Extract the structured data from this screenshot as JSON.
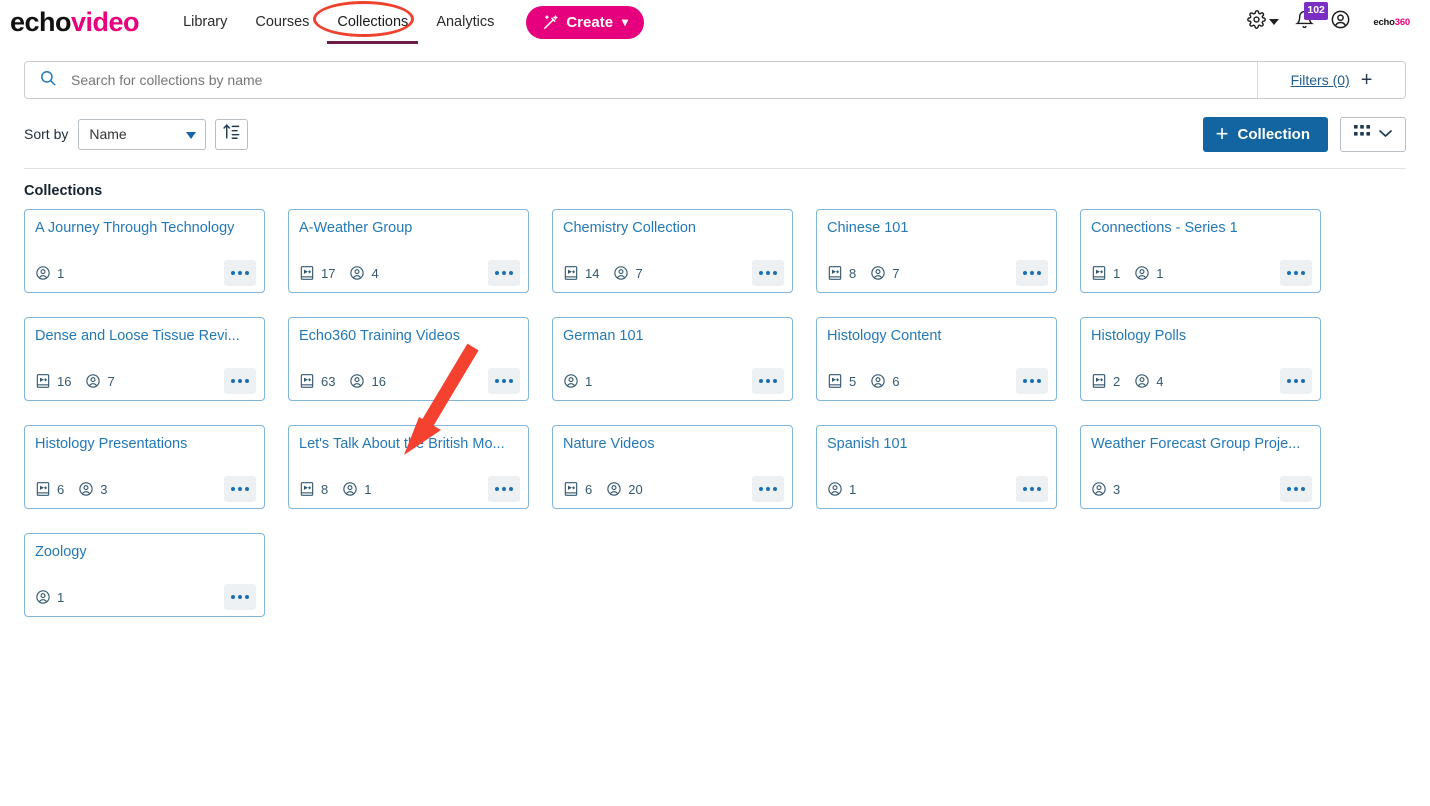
{
  "header": {
    "logo_echo": "echo",
    "logo_video": "video",
    "nav": [
      {
        "label": "Library",
        "active": false
      },
      {
        "label": "Courses",
        "active": false
      },
      {
        "label": "Collections",
        "active": true
      },
      {
        "label": "Analytics",
        "active": false
      }
    ],
    "create_label": "Create",
    "notification_count": "102",
    "mini_logo_a": "echo",
    "mini_logo_b": "360"
  },
  "search": {
    "placeholder": "Search for collections by name",
    "value": "",
    "filters_label": "Filters (0)"
  },
  "toolbar": {
    "sort_by_label": "Sort by",
    "sort_value": "Name",
    "add_collection_label": "Collection",
    "plus": "+"
  },
  "main": {
    "section_title": "Collections",
    "cards": [
      {
        "title": "A Journey Through Technology",
        "media": null,
        "people": "1"
      },
      {
        "title": "A-Weather Group",
        "media": "17",
        "people": "4"
      },
      {
        "title": "Chemistry Collection",
        "media": "14",
        "people": "7"
      },
      {
        "title": "Chinese 101",
        "media": "8",
        "people": "7"
      },
      {
        "title": "Connections - Series 1",
        "media": "1",
        "people": "1"
      },
      {
        "title": "Dense and Loose Tissue Revi...",
        "media": "16",
        "people": "7"
      },
      {
        "title": "Echo360 Training Videos",
        "media": "63",
        "people": "16"
      },
      {
        "title": "German 101",
        "media": null,
        "people": "1"
      },
      {
        "title": "Histology Content",
        "media": "5",
        "people": "6"
      },
      {
        "title": "Histology Polls",
        "media": "2",
        "people": "4"
      },
      {
        "title": "Histology Presentations",
        "media": "6",
        "people": "3"
      },
      {
        "title": "Let's Talk About the British Mo...",
        "media": "8",
        "people": "1"
      },
      {
        "title": "Nature Videos",
        "media": "6",
        "people": "20"
      },
      {
        "title": "Spanish 101",
        "media": null,
        "people": "1"
      },
      {
        "title": "Weather Forecast Group Proje...",
        "media": null,
        "people": "3"
      },
      {
        "title": "Zoology",
        "media": null,
        "people": "1"
      }
    ]
  },
  "colors": {
    "brand_pink": "#e6007e",
    "link_blue": "#2479b5",
    "primary_blue": "#1265a0",
    "annotation_red": "#f0412f",
    "badge_purple": "#7a2ec4",
    "tab_underline": "#6d1b47"
  }
}
